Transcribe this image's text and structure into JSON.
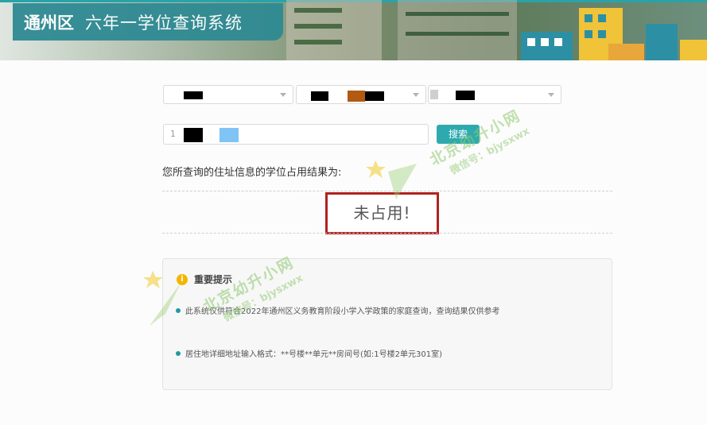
{
  "header": {
    "district": "通州区",
    "system_name": "六年一学位查询系统"
  },
  "form": {
    "select1_value": "",
    "select2_value": "",
    "select3_value": "",
    "address_value": "1",
    "search_label": "搜索"
  },
  "result": {
    "prompt": "您所查询的住址信息的学位占用结果为:",
    "value": "未占用!"
  },
  "notice": {
    "title": "重要提示",
    "items": [
      "此系统仅供符合2022年通州区义务教育阶段小学入学政策的家庭查询，查询结果仅供参考",
      "居住地详细地址输入格式：**号楼**单元**房间号(如:1号楼2单元301室)"
    ]
  },
  "watermark": {
    "name": "北京幼升小网",
    "wechat": "微信号：bjysxwx"
  },
  "colors": {
    "accent": "#2eaaaf",
    "result_border": "#b0221e",
    "info": "#f2b600"
  }
}
